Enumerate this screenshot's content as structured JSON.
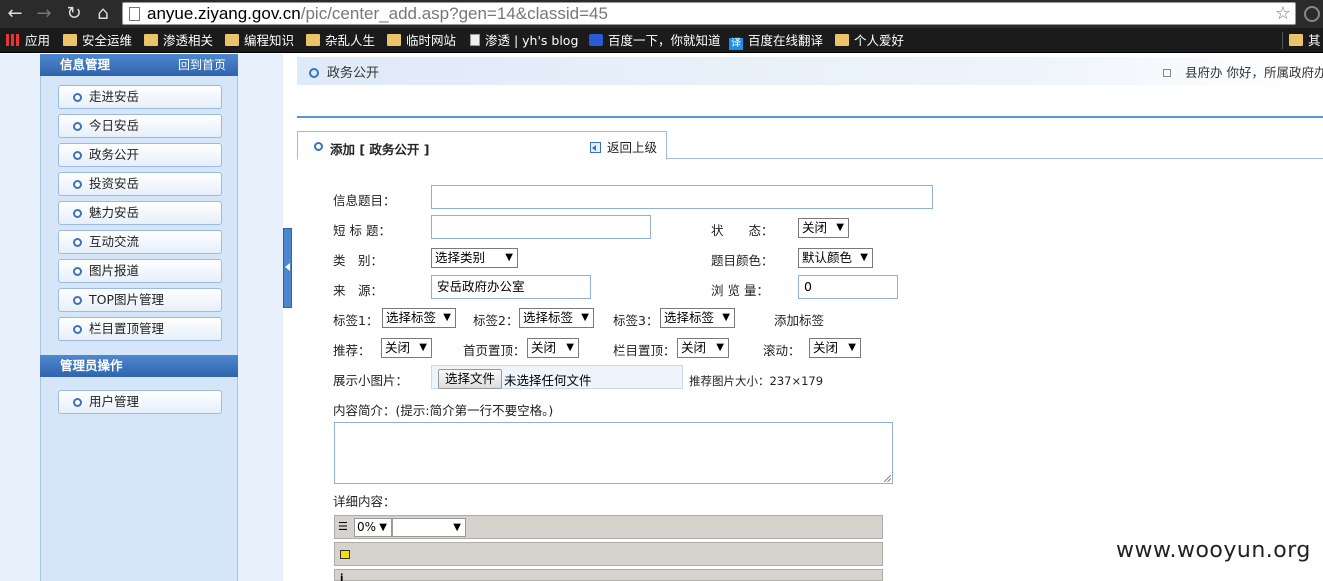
{
  "browser": {
    "url_host": "anyue.ziyang.gov.cn",
    "url_path": "/pic/center_add.asp?gen=14&classid=45",
    "bookmarks": [
      {
        "label": "应用",
        "icon": "apps-grid-icon"
      },
      {
        "label": "安全运维",
        "icon": "folder-icon"
      },
      {
        "label": "渗透相关",
        "icon": "folder-icon"
      },
      {
        "label": "编程知识",
        "icon": "folder-icon"
      },
      {
        "label": "杂乱人生",
        "icon": "folder-icon"
      },
      {
        "label": "临时网站",
        "icon": "folder-icon"
      },
      {
        "label": "渗透 | yh's blog",
        "icon": "page-icon"
      },
      {
        "label": "百度一下，你就知道",
        "icon": "baidu-paw-icon"
      },
      {
        "label": "百度在线翻译",
        "icon": "translate-icon"
      },
      {
        "label": "个人爱好",
        "icon": "folder-icon"
      },
      {
        "label": "其",
        "icon": "folder-icon"
      }
    ]
  },
  "sidebar": {
    "section1_title": "信息管理",
    "section1_link": "回到首页",
    "items": [
      "走进安岳",
      "今日安岳",
      "政务公开",
      "投资安岳",
      "魅力安岳",
      "互动交流",
      "图片报道",
      "TOP图片管理",
      "栏目置顶管理"
    ],
    "section2_title": "管理员操作",
    "items2": [
      "用户管理"
    ]
  },
  "header": {
    "title": "政务公开",
    "user_info": "县府办 你好，所属政府办"
  },
  "tab": {
    "title": "添加 [ 政务公开 ]",
    "back_label": "返回上级"
  },
  "form": {
    "title_label": "信息题目：",
    "title_value": "",
    "short_title_label": "短 标 题：",
    "short_title_value": "",
    "status_label": "状　　态：",
    "status_value": "关闭",
    "category_label": "类　别：",
    "category_value": "选择类别",
    "color_label": "题目颜色：",
    "color_value": "默认颜色",
    "source_label": "来　源：",
    "source_value": "安岳政府办公室",
    "views_label": "浏 览 量：",
    "views_value": "0",
    "tag1_label": "标签1：",
    "tag1_value": "选择标签",
    "tag2_label": "标签2：",
    "tag2_value": "选择标签",
    "tag3_label": "标签3：",
    "tag3_value": "选择标签",
    "add_tag_label": "添加标签",
    "recommend_label": "推荐：",
    "recommend_value": "关闭",
    "home_top_label": "首页置顶：",
    "home_top_value": "关闭",
    "column_top_label": "栏目置顶：",
    "column_top_value": "关闭",
    "scroll_label": "滚动：",
    "scroll_value": "关闭",
    "thumb_label": "展示小图片：",
    "file_button": "选择文件",
    "file_status": "未选择任何文件",
    "thumb_hint": "推荐图片大小：237×179",
    "summary_label": "内容简介：(提示:简介第一行不要空格。)",
    "detail_label": "详细内容：",
    "editor_zoom": "0%"
  },
  "watermark": "www.wooyun.org"
}
